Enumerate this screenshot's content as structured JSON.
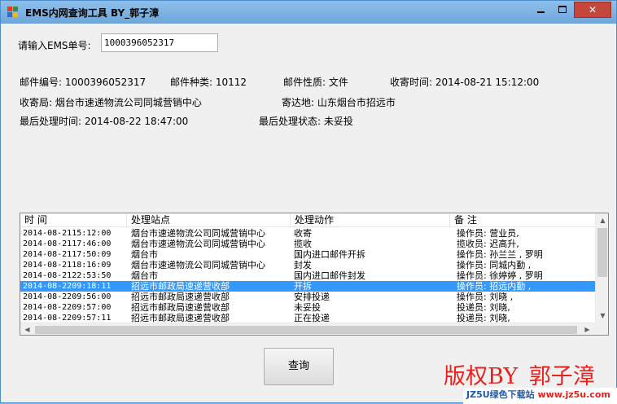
{
  "window": {
    "title": "EMS内网查询工具 BY_郭子漳",
    "close_label": "✕"
  },
  "form": {
    "ems_label": "请输入EMS单号:",
    "ems_value": "1000396052317"
  },
  "info": {
    "mail_no": "邮件编号: 1000396052317",
    "mail_type": "邮件种类: 10112",
    "mail_nature": "邮件性质: 文件",
    "receive_time": "收寄时间: 2014-08-21 15:12:00",
    "receive_office": "收寄局: 烟台市速递物流公司同城营销中心",
    "destination": "寄达地: 山东烟台市招远市",
    "last_time": "最后处理时间: 2014-08-22 18:47:00",
    "last_status": "最后处理状态: 未妥投"
  },
  "table": {
    "headers": [
      "时 间",
      "处理站点",
      "处理动作",
      "备 注"
    ],
    "rows": [
      [
        "2014-08-2115:12:00",
        "烟台市速递物流公司同城营销中心",
        "收寄",
        "操作员: 营业员,"
      ],
      [
        "2014-08-2117:46:00",
        "烟台市速递物流公司同城营销中心",
        "揽收",
        "揽收员: 迟高升,"
      ],
      [
        "2014-08-2117:50:09",
        "烟台市",
        "国内进口邮件开拆",
        "操作员: 孙兰兰 , 罗明"
      ],
      [
        "2014-08-2118:16:09",
        "烟台市速递物流公司同城营销中心",
        "封发",
        "操作员: 同城内勤 ,"
      ],
      [
        "2014-08-2122:53:50",
        "烟台市",
        "国内进口邮件封发",
        "操作员: 徐婷婷 , 罗明"
      ],
      [
        "2014-08-2209:18:11",
        "招远市邮政局速递营收部",
        "开拆",
        "操作员: 招远内勤 ,"
      ],
      [
        "2014-08-2209:56:00",
        "招远市邮政局速递营收部",
        "安排投递",
        "操作员: 刘晓 ,"
      ],
      [
        "2014-08-2209:57:00",
        "招远市邮政局速递营收部",
        "未妥投",
        "投递员: 刘晓,"
      ],
      [
        "2014-08-2209:57:11",
        "招远市邮政局速递营收部",
        "正在投递",
        "投递员: 刘晓,"
      ]
    ],
    "selected_index": 5
  },
  "buttons": {
    "query": "查询"
  },
  "copyright": "版权BY_郭子漳",
  "watermark": {
    "part1": "JZ5U绿色下载站",
    "part2": "www.jz5u.com"
  },
  "colors": {
    "selected_row": "#3399ff",
    "copyright": "#e8211c",
    "titlebar": "#8ec0ec"
  }
}
